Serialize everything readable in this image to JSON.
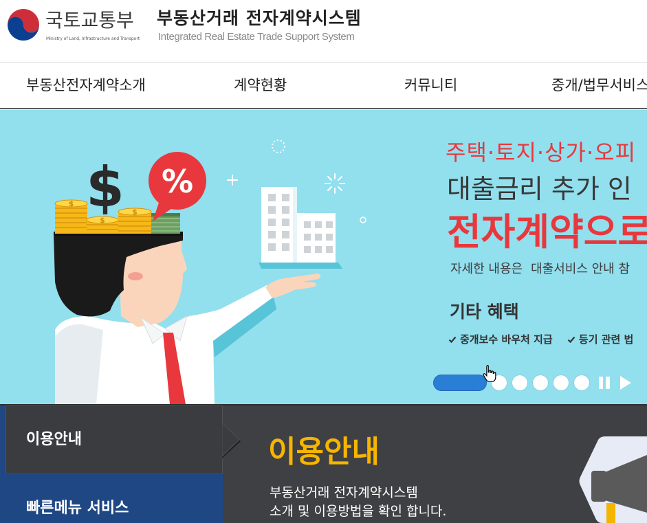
{
  "colors": {
    "brand_red": "#e8383d",
    "brand_blue": "#1f4784",
    "banner_bg": "#92dfee",
    "accent_yellow": "#f7b500",
    "indicator_blue": "#2b7ed6",
    "dark_panel": "#3f4043"
  },
  "header": {
    "emblem_icon": "government-emblem-icon",
    "ministry_name": "국토교통부",
    "ministry_name_en": "Ministry of Land, Infrastructure and Transport",
    "system_title": "부동산거래 전자계약시스템",
    "system_subtitle": "Integrated Real Estate Trade Support System"
  },
  "nav": {
    "items": [
      {
        "label": "부동산전자계약소개"
      },
      {
        "label": "계약현황"
      },
      {
        "label": "커뮤니티"
      },
      {
        "label": "중개/법무서비스"
      }
    ]
  },
  "banner": {
    "property_types": "주택·토지·상가·오피",
    "headline": "대출금리 추가 인",
    "highlight": "전자계약으로",
    "detail_prefix": "자세한 내용은",
    "detail_link": "대출서비스 안내 참",
    "benefits_title": "기타 혜택",
    "benefits": [
      {
        "icon": "check-icon",
        "label": "중개보수 바우처 지급"
      },
      {
        "icon": "check-icon",
        "label": "등기 관련 법"
      }
    ],
    "illustration": {
      "dollar_sign": "$",
      "percent_sign": "%"
    }
  },
  "carousel": {
    "slide_count": 6,
    "active_index": 0,
    "pause_icon": "pause-icon",
    "play_icon": "play-icon"
  },
  "cursor": {
    "icon": "hand-pointer-icon"
  },
  "sidebar": {
    "items": [
      {
        "label": "이용안내",
        "active": true
      },
      {
        "label": "빠른메뉴 서비스",
        "active": false
      }
    ]
  },
  "guide": {
    "title": "이용안내",
    "description_lines": [
      "부동산거래 전자계약시스템",
      "소개 및 이용방법을 확인 합니다."
    ],
    "icon": "megaphone-icon"
  }
}
